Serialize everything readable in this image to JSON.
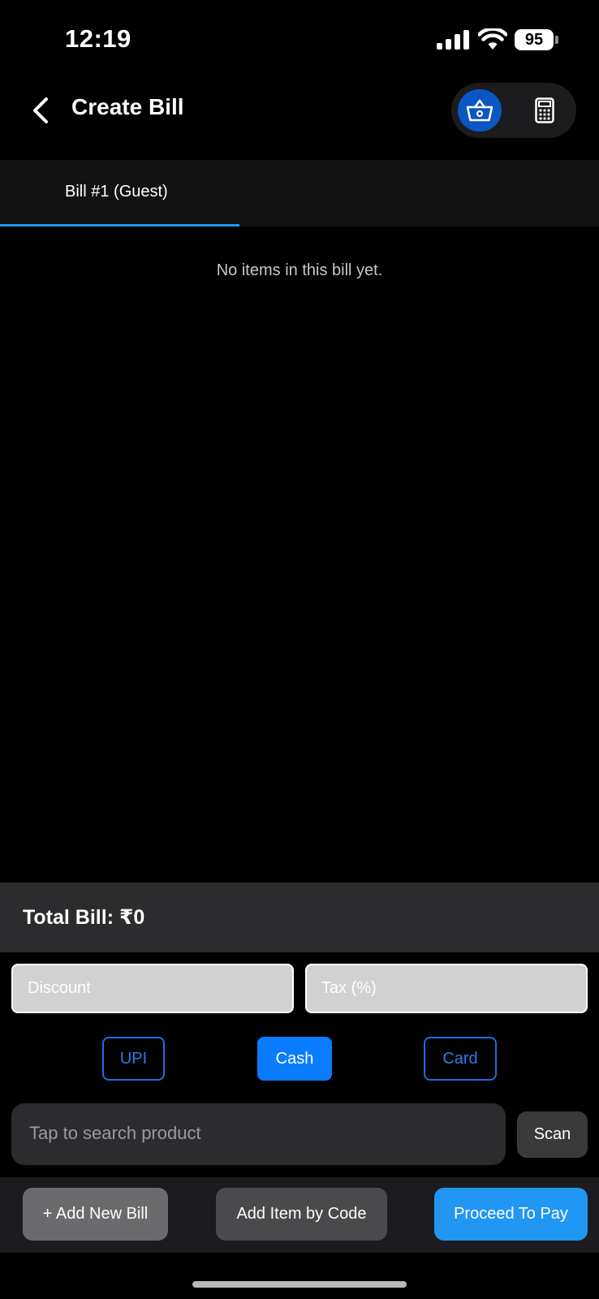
{
  "status_bar": {
    "time": "12:19",
    "battery": "95",
    "icons": [
      "signal-icon",
      "wifi-icon",
      "battery-icon"
    ]
  },
  "header": {
    "title": "Create Bill",
    "back_icon": "chevron-left-icon",
    "mode_toggle": {
      "options": [
        "basket-icon",
        "calculator-icon"
      ],
      "selected": "basket-icon",
      "accent": "#0a56c2"
    }
  },
  "tabs": [
    {
      "label": "Bill #1 (Guest)",
      "active": true
    }
  ],
  "bill": {
    "empty_message": "No items in this bill yet.",
    "total_label": "Total Bill: ₹0"
  },
  "inputs": {
    "discount_placeholder": "Discount",
    "tax_placeholder": "Tax (%)"
  },
  "payment_methods": {
    "options": [
      "UPI",
      "Cash",
      "Card"
    ],
    "selected": "Cash",
    "selected_color": "#0a7cff"
  },
  "search": {
    "placeholder": "Tap to search product",
    "scan_label": "Scan"
  },
  "actions": {
    "add_bill": "+ Add New Bill",
    "add_by_code": "Add Item by Code",
    "proceed": "Proceed To Pay",
    "proceed_color": "#2196f3"
  }
}
